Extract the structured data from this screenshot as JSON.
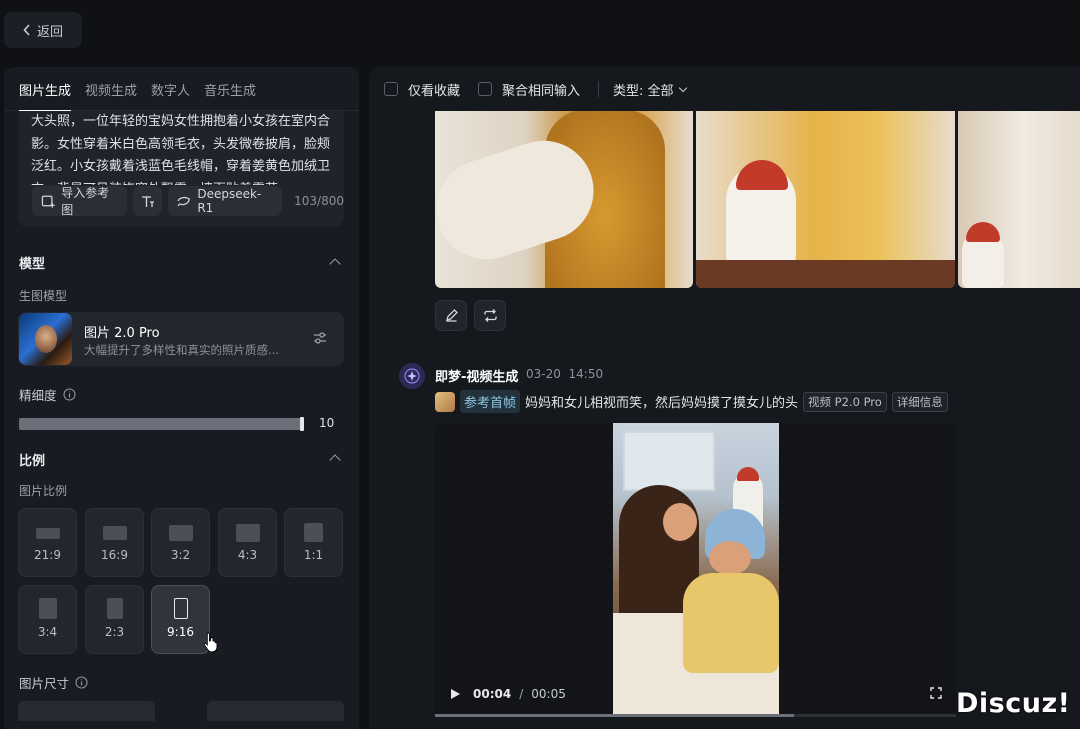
{
  "back_label": "返回",
  "tabs": [
    "图片生成",
    "视频生成",
    "数字人",
    "音乐生成"
  ],
  "prompt_text": "大头照，一位年轻的宝妈女性拥抱着小女孩在室内合影。女性穿着米白色高领毛衣，头发微卷披肩，脸颊泛红。小女孩戴着浅蓝色毛线帽，穿着姜黄色加绒卫衣，背景可见装饰窗外飘雪，墙面贴着雪花",
  "prompt_tools": {
    "import_ref": "导入参考图",
    "model_chip": "Deepseek-R1",
    "count": "103/800"
  },
  "model_section": {
    "title": "模型",
    "sub": "生图模型",
    "name": "图片 2.0 Pro",
    "desc": "大幅提升了多样性和真实的照片质感..."
  },
  "fineness": {
    "label": "精细度",
    "value": "10",
    "level": 1.0
  },
  "ratio_section": {
    "title": "比例",
    "sub": "图片比例",
    "options": [
      "21:9",
      "16:9",
      "3:2",
      "4:3",
      "1:1",
      "3:4",
      "2:3",
      "9:16"
    ],
    "selected": "9:16"
  },
  "size_label": "图片尺寸",
  "filter_bar": {
    "fav_only": "仅看收藏",
    "merge_inputs": "聚合相同输入",
    "type": "类型: 全部"
  },
  "post": {
    "author": "即梦-视频生成",
    "date": "03-20",
    "time": "14:50",
    "ref_label": "参考首帧",
    "prompt": "妈妈和女儿相视而笑，然后妈妈摸了摸女儿的头",
    "model_tag": "视频 P2.0 Pro",
    "detail_tag": "详细信息"
  },
  "video": {
    "current": "00:04",
    "duration": "00:05",
    "progress": 0.69
  },
  "watermark": "Discuz!"
}
